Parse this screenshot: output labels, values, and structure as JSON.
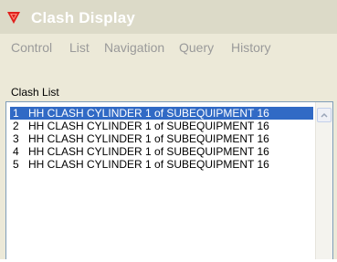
{
  "window": {
    "title": "Clash Display",
    "icon": "red-triangle-logo-icon"
  },
  "menu": [
    {
      "label": "Control"
    },
    {
      "label": "List"
    },
    {
      "label": "Navigation"
    },
    {
      "label": "Query"
    },
    {
      "label": "History"
    }
  ],
  "clash_list": {
    "label": "Clash List",
    "rows": [
      {
        "number": "1",
        "text": "HH CLASH CYLINDER 1 of SUBEQUIPMENT 16",
        "selected": true
      },
      {
        "number": "2",
        "text": "HH CLASH CYLINDER 1 of SUBEQUIPMENT 16 ",
        "selected": false
      },
      {
        "number": "3",
        "text": "HH CLASH CYLINDER 1 of SUBEQUIPMENT 16 ",
        "selected": false
      },
      {
        "number": "4",
        "text": "HH CLASH CYLINDER 1 of SUBEQUIPMENT 16 ",
        "selected": false
      },
      {
        "number": "5",
        "text": "HH CLASH CYLINDER 1 of SUBEQUIPMENT 16 ",
        "selected": false
      }
    ]
  },
  "colors": {
    "selection": "#316ac5",
    "menu_disabled_text": "#9a9a9a",
    "icon_red": "#e0201c"
  }
}
